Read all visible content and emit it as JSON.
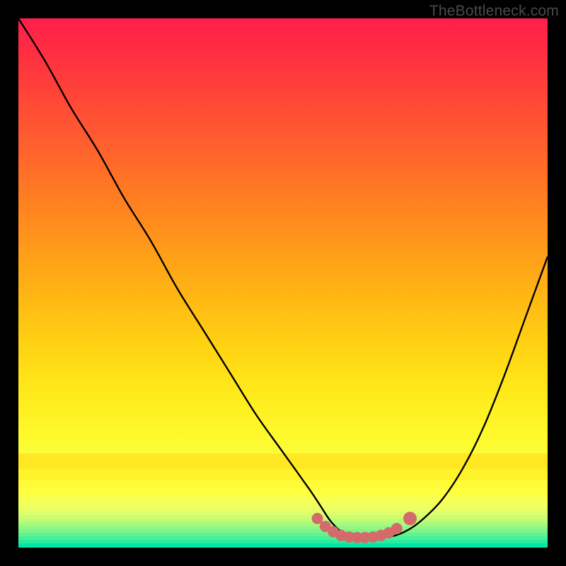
{
  "watermark": "TheBottleneck.com",
  "colors": {
    "frame": "#000000",
    "curve": "#000000",
    "marker_fill": "#d46a6a",
    "marker_stroke": "#b94f4f"
  },
  "chart_data": {
    "type": "line",
    "title": "",
    "xlabel": "",
    "ylabel": "",
    "xlim": [
      0,
      100
    ],
    "ylim": [
      0,
      100
    ],
    "grid": false,
    "legend": false,
    "series": [
      {
        "name": "bottleneck-curve",
        "x": [
          0,
          5,
          10,
          15,
          20,
          25,
          30,
          35,
          40,
          45,
          50,
          55,
          57,
          59,
          61,
          63,
          65,
          67,
          70,
          73,
          76,
          80,
          84,
          88,
          92,
          96,
          100
        ],
        "y": [
          100,
          92,
          83,
          75,
          66,
          58,
          49,
          41,
          33,
          25,
          18,
          11,
          8,
          5,
          3,
          2,
          2,
          2,
          2,
          3,
          5,
          9,
          15,
          23,
          33,
          44,
          55
        ]
      }
    ],
    "markers": [
      {
        "x": 56.5,
        "y": 5.5
      },
      {
        "x": 58.0,
        "y": 4.0
      },
      {
        "x": 59.5,
        "y": 3.0
      },
      {
        "x": 61.0,
        "y": 2.3
      },
      {
        "x": 62.5,
        "y": 2.0
      },
      {
        "x": 64.0,
        "y": 1.9
      },
      {
        "x": 65.5,
        "y": 1.9
      },
      {
        "x": 67.0,
        "y": 2.0
      },
      {
        "x": 68.5,
        "y": 2.3
      },
      {
        "x": 70.0,
        "y": 2.8
      },
      {
        "x": 71.5,
        "y": 3.6
      },
      {
        "x": 74.0,
        "y": 5.5
      }
    ],
    "background_gradient": {
      "top": "#ff1f4a",
      "mid": "#ffe81a",
      "bottom": "#00f5b0"
    }
  }
}
